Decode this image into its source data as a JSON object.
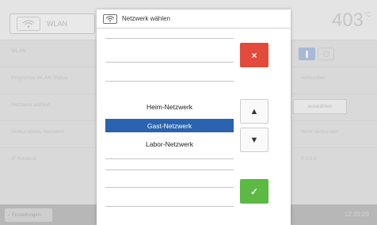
{
  "background": {
    "wlan_label": "WLAN",
    "temperature": "403",
    "temperature_unit": "°C",
    "rows": [
      {
        "label": "WLAN",
        "value": ""
      },
      {
        "label": "Programat WLAN Status",
        "value": "verbunden"
      },
      {
        "label": "Netzwerk wählen",
        "value": "auswählen"
      },
      {
        "label": "Verbundenes Netzwerk",
        "value": "Nicht verbunden"
      },
      {
        "label": "IP-Adresse",
        "value": "0.0.0.0"
      }
    ],
    "back_label": "Einstellungen",
    "time": "12:39:09"
  },
  "dialog": {
    "title": "Netzwerk wählen",
    "networks": [
      "Heim-Netzwerk",
      "Gast-Netzwerk",
      "Labor-Netzwerk"
    ],
    "selected_index": 1,
    "cancel_symbol": "×",
    "ok_symbol": "✓",
    "up_symbol": "▲",
    "down_symbol": "▼"
  },
  "colors": {
    "accent_selected": "#2a63b0",
    "cancel": "#e24a3b",
    "confirm": "#5cb943"
  }
}
